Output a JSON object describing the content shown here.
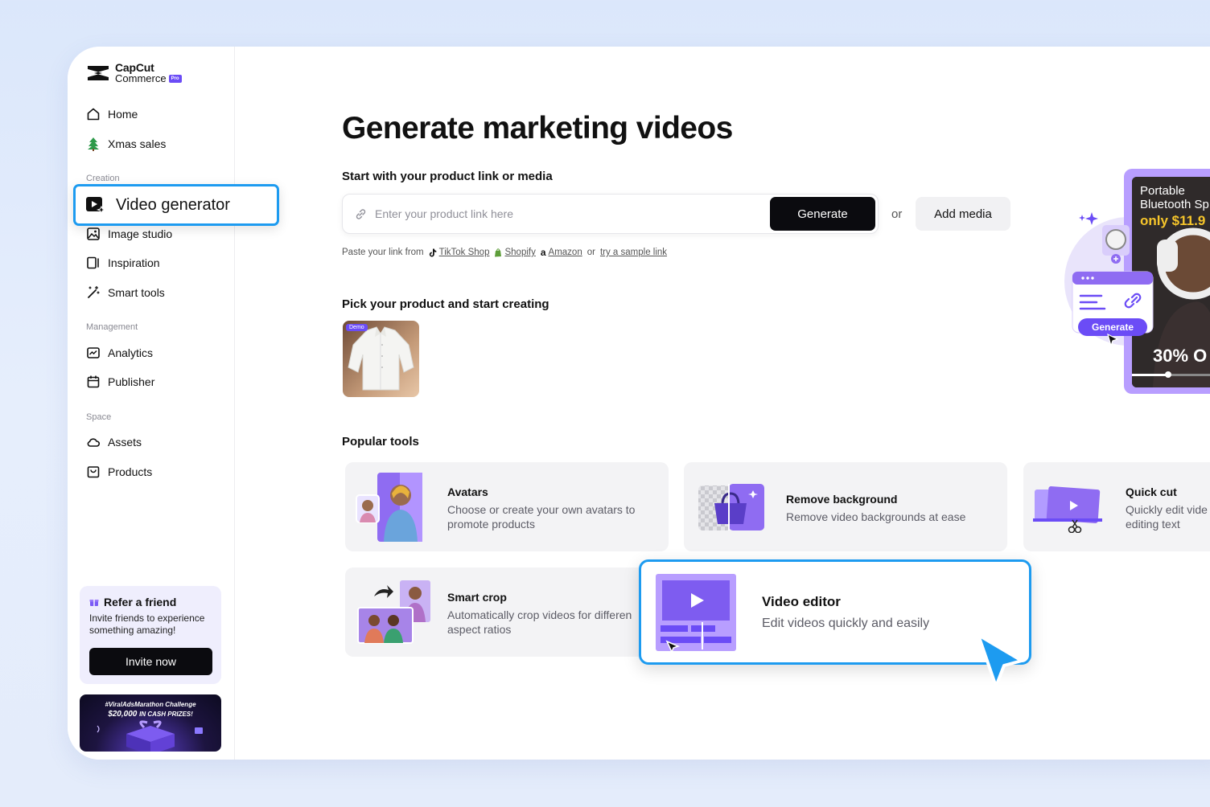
{
  "logo": {
    "line1": "CapCut",
    "line2": "Commerce",
    "badge": "Pro"
  },
  "sidebar": {
    "home": "Home",
    "xmas": "Xmas sales",
    "section_creation": "Creation",
    "video_generator": "Video generator",
    "image_studio": "Image studio",
    "inspiration": "Inspiration",
    "smart_tools": "Smart tools",
    "section_management": "Management",
    "analytics": "Analytics",
    "publisher": "Publisher",
    "section_space": "Space",
    "assets": "Assets",
    "products": "Products"
  },
  "refer": {
    "title": "Refer a friend",
    "desc": "Invite friends to experience something amazing!",
    "button": "Invite now"
  },
  "promo": {
    "line1": "#ViralAdsMarathon Challenge",
    "amount": "$20,000",
    "line2": "IN CASH PRIZES!"
  },
  "main": {
    "title": "Generate marketing videos",
    "subtitle": "Start with your product link or media",
    "link_placeholder": "Enter your product link here",
    "generate": "Generate",
    "or": "or",
    "add_media": "Add media",
    "paste_prefix": "Paste your link from",
    "tiktok": "TikTok Shop",
    "shopify": "Shopify",
    "amazon": "Amazon",
    "or2": "or",
    "sample": "try a sample link",
    "pick_title": "Pick your product and start creating",
    "demo_badge": "Demo",
    "popular_title": "Popular tools"
  },
  "tools": {
    "avatars": {
      "title": "Avatars",
      "desc1": "Choose or create your own avatars to",
      "desc2": "promote products"
    },
    "remove_bg": {
      "title": "Remove background",
      "desc": "Remove video backgrounds at ease"
    },
    "quick_cut": {
      "title": "Quick cut",
      "desc1": "Quickly edit vide",
      "desc2": "editing text"
    },
    "smart_crop": {
      "title": "Smart crop",
      "desc1": "Automatically crop videos for differen",
      "desc2": "aspect ratios"
    },
    "video_editor": {
      "title": "Video editor",
      "desc": "Edit videos quickly and easily"
    }
  },
  "hero": {
    "line1": "Portable",
    "line2": "Bluetooth Sp",
    "price": "only $11.9",
    "discount": "30% O",
    "generate": "Generate"
  },
  "colors": {
    "accent": "#1d9bf0",
    "brand_purple": "#6b4cf6",
    "button_dark": "#0b0b0f"
  }
}
